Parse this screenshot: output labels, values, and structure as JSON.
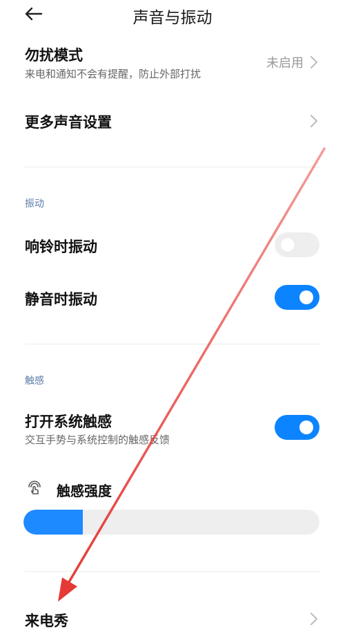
{
  "header": {
    "title": "声音与振动"
  },
  "dnd": {
    "title": "勿扰模式",
    "subtitle": "来电和通知不会有提醒，防止外部打扰",
    "value": "未启用"
  },
  "more_sound": {
    "title": "更多声音设置"
  },
  "vibration_section": {
    "label": "振动",
    "ring_vibrate": {
      "title": "响铃时振动",
      "enabled": false
    },
    "silent_vibrate": {
      "title": "静音时振动",
      "enabled": true
    }
  },
  "haptics_section": {
    "label": "触感",
    "system_haptics": {
      "title": "打开系统触感",
      "subtitle": "交互手势与系统控制的触感反馈",
      "enabled": true
    },
    "haptic_strength": {
      "label": "触感强度",
      "level": 0.2
    }
  },
  "ringtone_show": {
    "title": "来电秀"
  },
  "colors": {
    "accent": "#0d84ff",
    "annotation_arrow": "#e53935"
  },
  "icons": {
    "back": "back-arrow-icon",
    "chevron": "chevron-right-icon",
    "haptic": "haptic-touch-icon"
  }
}
